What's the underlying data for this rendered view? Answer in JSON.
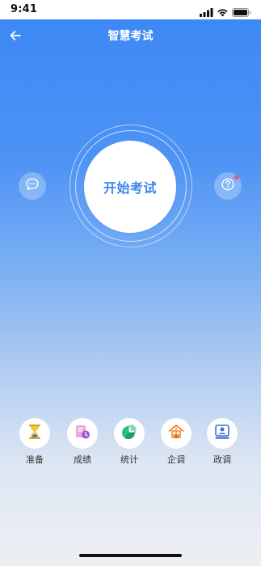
{
  "status_bar": {
    "time": "9:41",
    "signal_icon": "cellular-signal-icon",
    "wifi_icon": "wifi-icon",
    "battery_icon": "battery-icon"
  },
  "nav": {
    "title": "智慧考试",
    "back_icon": "arrow-left-icon"
  },
  "main": {
    "start_label": "开始考试",
    "chat_icon": "chat-bubble-icon",
    "help_icon": "question-icon",
    "help_has_notification": true
  },
  "features": [
    {
      "label": "准备",
      "icon": "hourglass-icon"
    },
    {
      "label": "成绩",
      "icon": "report-clock-icon"
    },
    {
      "label": "统计",
      "icon": "pie-chart-icon"
    },
    {
      "label": "企调",
      "icon": "building-icon"
    },
    {
      "label": "政调",
      "icon": "person-badge-icon"
    }
  ],
  "colors": {
    "primary": "#3c86ef",
    "notification": "#ff4d4f"
  }
}
